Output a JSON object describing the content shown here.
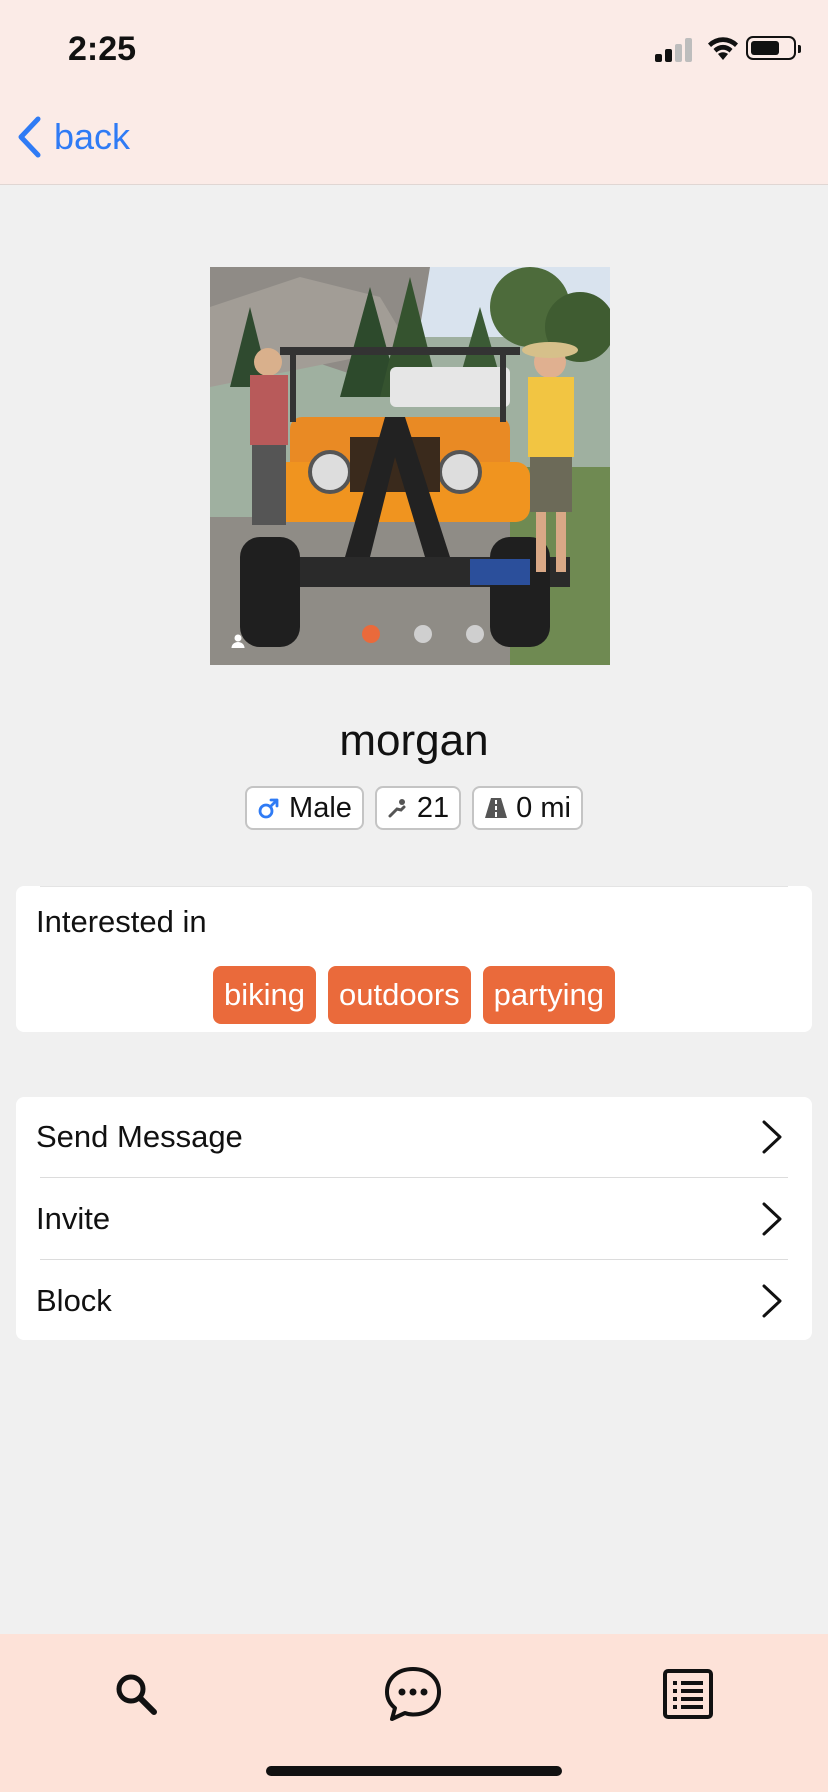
{
  "status_bar": {
    "time": "2:25"
  },
  "nav": {
    "back_label": "back"
  },
  "profile": {
    "name": "morgan",
    "gender": "Male",
    "age": "21",
    "distance": "0 mi",
    "photo": {
      "total": 3,
      "current": 1
    }
  },
  "interests": {
    "title": "Interested in",
    "tags": [
      "biking",
      "outdoors",
      "partying"
    ]
  },
  "actions": [
    {
      "label": "Send Message"
    },
    {
      "label": "Invite"
    },
    {
      "label": "Block"
    }
  ],
  "tabs": [
    "search-icon",
    "chat-icon",
    "list-icon"
  ],
  "colors": {
    "accent": "#ea6a3b",
    "link": "#2f7bf5",
    "header_bg": "#fbebe7",
    "tabbar_bg": "#fde2d8",
    "page_bg": "#f0f0f0"
  }
}
